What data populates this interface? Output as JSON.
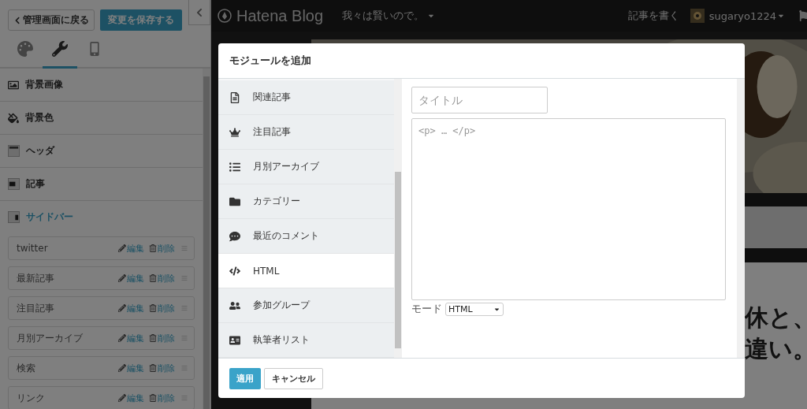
{
  "sidebar": {
    "back_button": "管理画面に戻る",
    "save_button": "変更を保存する",
    "tabs": [
      {
        "kind": "design",
        "selected": false
      },
      {
        "kind": "customize",
        "selected": true
      },
      {
        "kind": "smartphone",
        "selected": false
      }
    ],
    "sections": [
      {
        "kind": "background-image",
        "label": "背景画像",
        "selected": false
      },
      {
        "kind": "background-color",
        "label": "背景色",
        "selected": false
      },
      {
        "kind": "header",
        "label": "ヘッダ",
        "selected": false
      },
      {
        "kind": "article",
        "label": "記事",
        "selected": false
      },
      {
        "kind": "sidebar",
        "label": "サイドバー",
        "selected": true
      }
    ],
    "modules": [
      {
        "name": "twitter",
        "edit": "編集",
        "delete": "削除"
      },
      {
        "name": "最新記事",
        "edit": "編集",
        "delete": "削除"
      },
      {
        "name": "注目記事",
        "edit": "編集",
        "delete": "削除"
      },
      {
        "name": "月別アーカイブ",
        "edit": "編集",
        "delete": "削除"
      },
      {
        "name": "検索",
        "edit": "編集",
        "delete": "削除"
      },
      {
        "name": "リンク",
        "edit": "編集",
        "delete": "削除"
      }
    ]
  },
  "blog": {
    "logo": "Hatena Blog",
    "blog_title": "我々は賢いので。",
    "write_link": "記事を書く",
    "username": "sugaryo1224",
    "article_heading_lines": [
      "休と、",
      "違い。"
    ]
  },
  "dialog": {
    "title": "モジュールを追加",
    "module_types": [
      {
        "kind": "related",
        "label": "関連記事",
        "selected": false
      },
      {
        "kind": "featured",
        "label": "注目記事",
        "selected": false
      },
      {
        "kind": "archive",
        "label": "月別アーカイブ",
        "selected": false
      },
      {
        "kind": "category",
        "label": "カテゴリー",
        "selected": false
      },
      {
        "kind": "comments",
        "label": "最近のコメント",
        "selected": false
      },
      {
        "kind": "html",
        "label": "HTML",
        "selected": true
      },
      {
        "kind": "group",
        "label": "参加グループ",
        "selected": false
      },
      {
        "kind": "authors",
        "label": "執筆者リスト",
        "selected": false
      }
    ],
    "title_field": {
      "placeholder": "タイトル"
    },
    "body_field": {
      "placeholder": "<p> … </p>"
    },
    "mode_label": "モード",
    "mode_value": "HTML",
    "apply_button": "適用",
    "cancel_button": "キャンセル"
  }
}
